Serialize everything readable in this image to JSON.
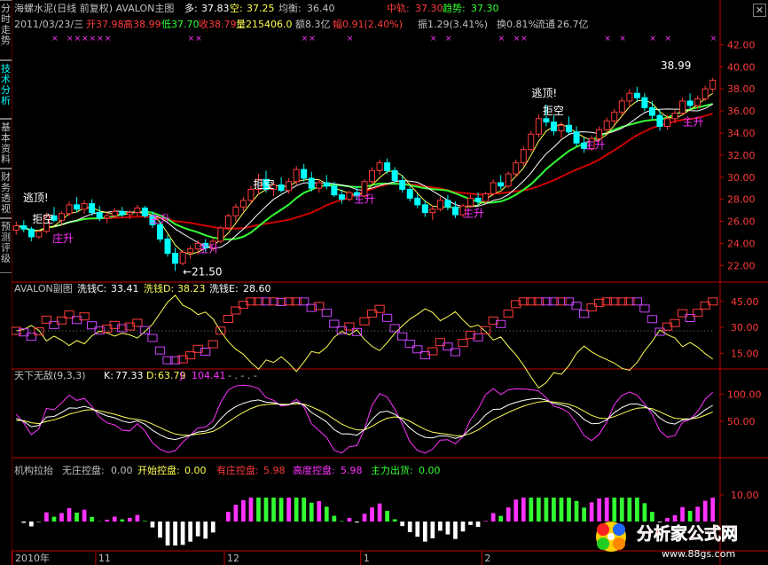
{
  "sidebar": {
    "tabs": [
      "分时走势",
      "技术分析",
      "基本资料",
      "财务透视",
      "预测评级"
    ],
    "active": 1
  },
  "colors": {
    "up": "#ff3b3b",
    "down": "#00ffff",
    "white": "#ffffff",
    "yellow": "#ffff55",
    "magenta": "#ff33ff",
    "green": "#33ff33",
    "darkred": "#cc0000",
    "gray": "#c0c0c0",
    "grid": "#7a0000",
    "axis": "#c00000"
  },
  "main": {
    "title": "海螺水泥(日线 前复权) AVALON主图",
    "duo_label": "多: ",
    "duo": "37.83",
    "kong_label": "空: ",
    "kong": "37.25",
    "junheng_label": "均衡: ",
    "junheng": "36.40",
    "zhonggui_label": "中轨: ",
    "zhonggui": "37.30",
    "qushi_label": "趋势: ",
    "qushi": "37.30",
    "date": "2011/03/23/三",
    "open_label": "开",
    "open": "37.98",
    "high_label": "高",
    "high": "38.99",
    "low_label": "低",
    "low": "37.70",
    "close_label": "收",
    "close": "38.79",
    "vol_label": "量",
    "vol": "215406.0",
    "amt_label": "额",
    "amt": "8.3亿",
    "fu_label": "幅",
    "fu": "0.91(2.40%)",
    "zhen_label": "振",
    "zhen": "1.29(3.41%)",
    "huan_label": "换",
    "huan": "0.81%",
    "liutong_label": "流通",
    "liutong": "26.7亿",
    "annotations": {
      "taoding": "逃顶!",
      "jukong": "拒空",
      "zhuangsheng": "庄升",
      "zhusheng": "主升",
      "low_marker": "←21.50",
      "high_marker": "38.99"
    }
  },
  "sub1": {
    "title": "AVALON副图",
    "c_label": "洗钱C: ",
    "c": "33.41",
    "d_label": "洗钱D: ",
    "d": "38.23",
    "e_label": "洗钱E: ",
    "e": "28.60"
  },
  "sub2": {
    "title": "天下无敌(9,3,3)",
    "k_label": "K: ",
    "k": "77.33",
    "d_label": "D: ",
    "d": "63.79",
    "j_label": "J: ",
    "j": "104.41",
    "extra": "- . - . -"
  },
  "sub3": {
    "title": "机构拉抬",
    "a_label": "无庄控盘: ",
    "a": "0.00",
    "b_label": "开始控盘: ",
    "b": "0.00",
    "c_label": "有庄控盘: ",
    "c": "5.98",
    "d_label": "高度控盘: ",
    "d": "5.98",
    "e_label": "主力出货: ",
    "e": "0.00"
  },
  "xaxis": [
    "2010年",
    "11",
    "12",
    "1",
    "2"
  ],
  "watermark": {
    "text": "分析家公式网",
    "url": "www.88gs.com"
  },
  "chart_data": [
    {
      "type": "candlestick",
      "name": "main",
      "ylim": [
        20.5,
        43
      ],
      "yticks": [
        22,
        24,
        26,
        28,
        30,
        32,
        34,
        36,
        38,
        40,
        42
      ],
      "ohlc": [
        [
          25.2,
          26.0,
          24.8,
          25.6
        ],
        [
          25.6,
          26.1,
          25.0,
          25.3
        ],
        [
          25.3,
          25.5,
          24.2,
          24.6
        ],
        [
          24.6,
          25.2,
          24.4,
          25.1
        ],
        [
          25.1,
          26.8,
          24.9,
          26.5
        ],
        [
          26.5,
          27.3,
          25.9,
          26.1
        ],
        [
          26.1,
          26.9,
          25.6,
          26.7
        ],
        [
          26.7,
          27.8,
          26.5,
          27.5
        ],
        [
          27.5,
          28.2,
          26.8,
          27.1
        ],
        [
          27.1,
          27.9,
          26.7,
          27.6
        ],
        [
          27.6,
          28.0,
          26.5,
          26.8
        ],
        [
          26.8,
          27.4,
          26.0,
          26.3
        ],
        [
          26.3,
          26.8,
          25.8,
          26.5
        ],
        [
          26.5,
          27.2,
          26.3,
          26.9
        ],
        [
          26.9,
          27.3,
          26.4,
          26.6
        ],
        [
          26.6,
          27.0,
          26.2,
          26.8
        ],
        [
          26.8,
          27.5,
          26.5,
          27.2
        ],
        [
          27.2,
          27.4,
          26.3,
          26.5
        ],
        [
          26.5,
          26.9,
          25.4,
          25.7
        ],
        [
          25.7,
          26.0,
          24.1,
          24.4
        ],
        [
          24.4,
          24.8,
          22.8,
          23.1
        ],
        [
          23.1,
          23.6,
          21.5,
          22.2
        ],
        [
          22.2,
          23.4,
          22.0,
          23.2
        ],
        [
          23.2,
          23.8,
          22.6,
          23.5
        ],
        [
          23.5,
          24.3,
          23.0,
          24.0
        ],
        [
          24.0,
          24.4,
          23.2,
          23.6
        ],
        [
          23.6,
          24.5,
          23.3,
          24.2
        ],
        [
          24.2,
          25.6,
          24.0,
          25.4
        ],
        [
          25.4,
          26.7,
          25.2,
          26.5
        ],
        [
          26.5,
          27.6,
          26.0,
          27.3
        ],
        [
          27.3,
          28.2,
          26.9,
          27.9
        ],
        [
          27.9,
          29.2,
          27.6,
          28.9
        ],
        [
          28.9,
          30.3,
          28.4,
          29.8
        ],
        [
          29.8,
          30.6,
          28.6,
          28.9
        ],
        [
          28.9,
          29.6,
          28.3,
          29.3
        ],
        [
          29.3,
          30.0,
          28.6,
          28.8
        ],
        [
          28.8,
          29.9,
          28.5,
          29.6
        ],
        [
          29.6,
          31.0,
          29.3,
          30.7
        ],
        [
          30.7,
          31.2,
          29.6,
          29.9
        ],
        [
          29.9,
          30.5,
          28.7,
          29.0
        ],
        [
          29.0,
          29.8,
          28.6,
          29.5
        ],
        [
          29.5,
          30.2,
          28.9,
          29.2
        ],
        [
          29.2,
          29.6,
          28.2,
          28.4
        ],
        [
          28.4,
          28.9,
          27.6,
          28.0
        ],
        [
          28.0,
          28.8,
          27.8,
          28.6
        ],
        [
          28.6,
          29.2,
          28.0,
          28.3
        ],
        [
          28.3,
          29.8,
          28.1,
          29.6
        ],
        [
          29.6,
          30.9,
          29.4,
          30.6
        ],
        [
          30.6,
          31.6,
          30.2,
          31.3
        ],
        [
          31.3,
          31.7,
          30.3,
          30.6
        ],
        [
          30.6,
          30.9,
          29.4,
          29.7
        ],
        [
          29.7,
          30.2,
          28.6,
          28.9
        ],
        [
          28.9,
          29.3,
          27.8,
          28.1
        ],
        [
          28.1,
          28.5,
          27.2,
          27.5
        ],
        [
          27.5,
          27.9,
          26.4,
          26.8
        ],
        [
          26.8,
          27.4,
          26.1,
          27.1
        ],
        [
          27.1,
          28.2,
          26.9,
          27.9
        ],
        [
          27.9,
          28.4,
          27.0,
          27.3
        ],
        [
          27.3,
          27.8,
          26.3,
          26.6
        ],
        [
          26.6,
          27.6,
          26.4,
          27.4
        ],
        [
          27.4,
          28.4,
          27.2,
          28.1
        ],
        [
          28.1,
          28.6,
          27.4,
          27.8
        ],
        [
          27.8,
          28.7,
          27.6,
          28.5
        ],
        [
          28.5,
          29.8,
          28.3,
          29.5
        ],
        [
          29.5,
          30.2,
          28.9,
          29.2
        ],
        [
          29.2,
          30.5,
          29.0,
          30.3
        ],
        [
          30.3,
          31.6,
          30.0,
          31.3
        ],
        [
          31.3,
          32.8,
          31.0,
          32.5
        ],
        [
          32.5,
          34.2,
          32.3,
          33.9
        ],
        [
          33.9,
          35.7,
          33.6,
          35.3
        ],
        [
          35.3,
          36.6,
          34.6,
          35.0
        ],
        [
          35.0,
          35.6,
          33.8,
          34.2
        ],
        [
          34.2,
          35.0,
          33.5,
          34.7
        ],
        [
          34.7,
          35.5,
          33.9,
          34.1
        ],
        [
          34.1,
          34.6,
          32.8,
          33.1
        ],
        [
          33.1,
          33.6,
          32.2,
          32.6
        ],
        [
          32.6,
          33.8,
          32.4,
          33.5
        ],
        [
          33.5,
          34.6,
          33.2,
          34.3
        ],
        [
          34.3,
          35.4,
          34.0,
          35.1
        ],
        [
          35.1,
          36.2,
          34.8,
          35.9
        ],
        [
          35.9,
          37.2,
          35.6,
          36.9
        ],
        [
          36.9,
          38.0,
          36.3,
          37.6
        ],
        [
          37.6,
          38.2,
          36.8,
          37.2
        ],
        [
          37.2,
          37.6,
          36.0,
          36.3
        ],
        [
          36.3,
          36.9,
          35.2,
          35.6
        ],
        [
          35.6,
          36.1,
          34.2,
          34.6
        ],
        [
          34.6,
          35.6,
          34.3,
          35.3
        ],
        [
          35.3,
          36.1,
          34.9,
          35.8
        ],
        [
          35.8,
          37.2,
          35.6,
          36.9
        ],
        [
          36.9,
          37.6,
          36.1,
          36.5
        ],
        [
          36.5,
          37.4,
          36.2,
          37.1
        ],
        [
          37.1,
          38.3,
          36.9,
          38.0
        ],
        [
          37.98,
          38.99,
          37.7,
          38.79
        ]
      ],
      "lines": {
        "yellow": "MA short",
        "white": "MA medium",
        "green": "Qushi",
        "darkred": "Zhonggui"
      }
    },
    {
      "type": "line",
      "name": "AVALON副图",
      "ylim": [
        8,
        48
      ],
      "yticks": [
        15,
        30,
        45
      ],
      "series": [
        {
          "name": "洗钱C",
          "last": 33.41
        },
        {
          "name": "洗钱D",
          "last": 38.23
        },
        {
          "name": "洗钱E",
          "last": 28.6
        }
      ]
    },
    {
      "type": "line",
      "name": "天下无敌(9,3,3)",
      "ylim": [
        -10,
        120
      ],
      "yticks": [
        50,
        100
      ],
      "series": [
        {
          "name": "K",
          "last": 77.33
        },
        {
          "name": "D",
          "last": 63.79
        },
        {
          "name": "J",
          "last": 104.41
        }
      ]
    },
    {
      "type": "bar",
      "name": "机构拉抬",
      "ylim": [
        -10,
        16
      ],
      "yticks": [
        10
      ],
      "series": [
        {
          "name": "有庄控盘",
          "last": 5.98
        },
        {
          "name": "高度控盘",
          "last": 5.98
        }
      ]
    }
  ]
}
